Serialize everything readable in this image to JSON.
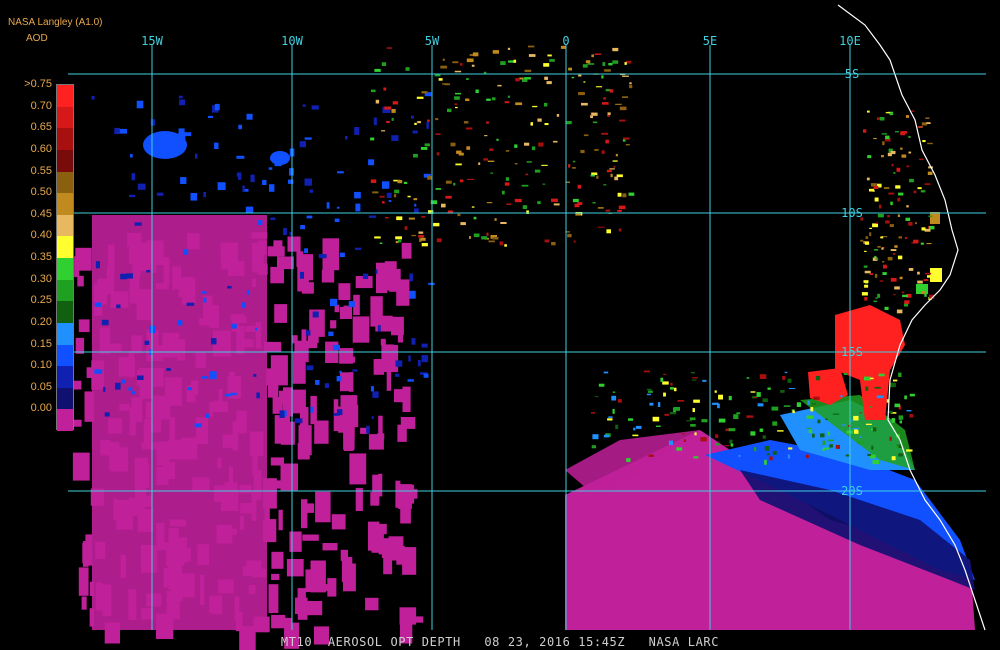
{
  "header": {
    "title": "NASA Langley (A1.0)",
    "units": "AOD"
  },
  "legend": {
    "labels": [
      ">0.75",
      "0.70",
      "0.65",
      "0.60",
      "0.55",
      "0.50",
      "0.45",
      "0.40",
      "0.35",
      "0.30",
      "0.25",
      "0.20",
      "0.15",
      "0.10",
      "0.05",
      "0.00"
    ],
    "colors": [
      "#ff2020",
      "#d61818",
      "#a81010",
      "#7a0b0b",
      "#8a6010",
      "#c08a1f",
      "#e8b860",
      "#ffff30",
      "#30d030",
      "#20a020",
      "#106010",
      "#2090ff",
      "#1050ff",
      "#1020b0",
      "#101070",
      "#c0209a"
    ]
  },
  "map": {
    "lon_labels": [
      "15W",
      "10W",
      "5W",
      "0",
      "5E",
      "10E"
    ],
    "lat_labels": [
      "5S",
      "10S",
      "15S",
      "20S"
    ],
    "grid_color": "#40d0e0",
    "coast_color": "#ffffff",
    "background": "#000000",
    "clear_sky_color": "#c0209a"
  },
  "footer": {
    "text": "MT10  AEROSOL OPT DEPTH   08 23, 2016 15:45Z   NASA LARC"
  }
}
